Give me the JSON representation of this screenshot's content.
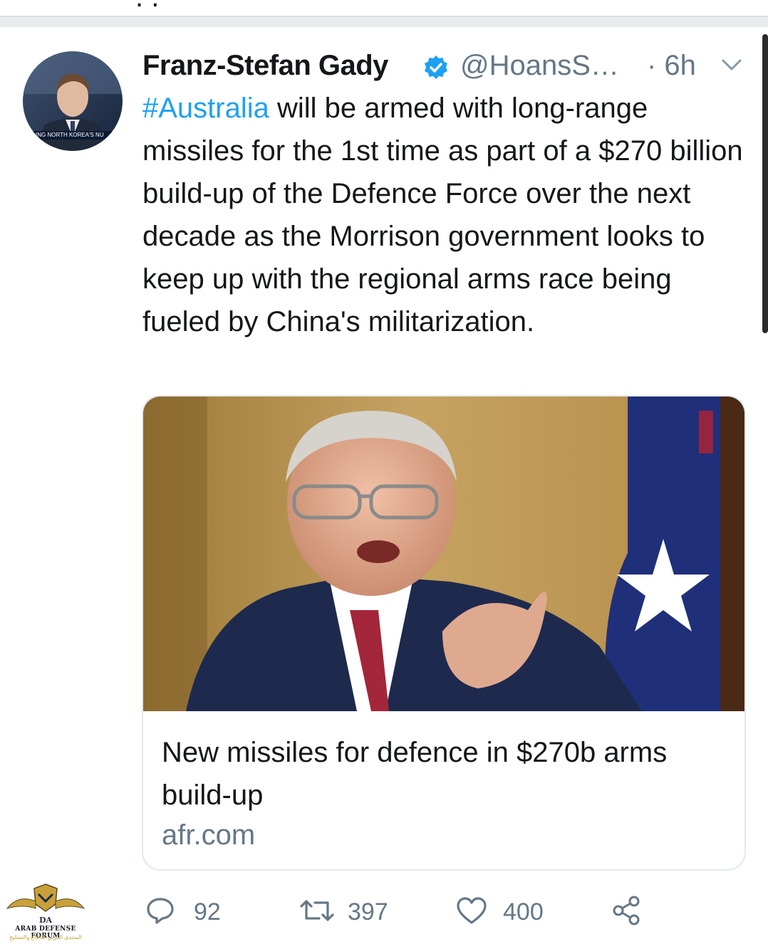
{
  "tweet": {
    "author_name": "Franz-Stefan Gady",
    "handle": "@HoansS…",
    "time": "· 6h",
    "hashtag": "#Australia",
    "text_after_hashtag": " will be armed with long-range missiles for the 1st time as part of a $270 billion build-up of the Defence Force over the next decade as the Morrison government looks to keep up with the regional arms race being fueled by China's militarization.",
    "avatar_caption": "ING NORTH KOREA'S NU"
  },
  "card": {
    "title": "New missiles for defence in $270b arms build-up",
    "domain": "afr.com"
  },
  "actions": {
    "replies": "92",
    "retweets": "397",
    "likes": "400"
  },
  "watermark": {
    "abbr": "DA",
    "name": "ARAB DEFENSE FORUM",
    "arabic": "المنتدى العربي للدفاع والتسليح"
  },
  "colors": {
    "link_blue": "#1da1f2",
    "muted": "#657786",
    "text": "#14171a",
    "border": "#e1e8ed"
  },
  "icons": [
    "verified-badge-icon",
    "chevron-down-icon",
    "reply-icon",
    "retweet-icon",
    "like-icon",
    "share-icon"
  ]
}
